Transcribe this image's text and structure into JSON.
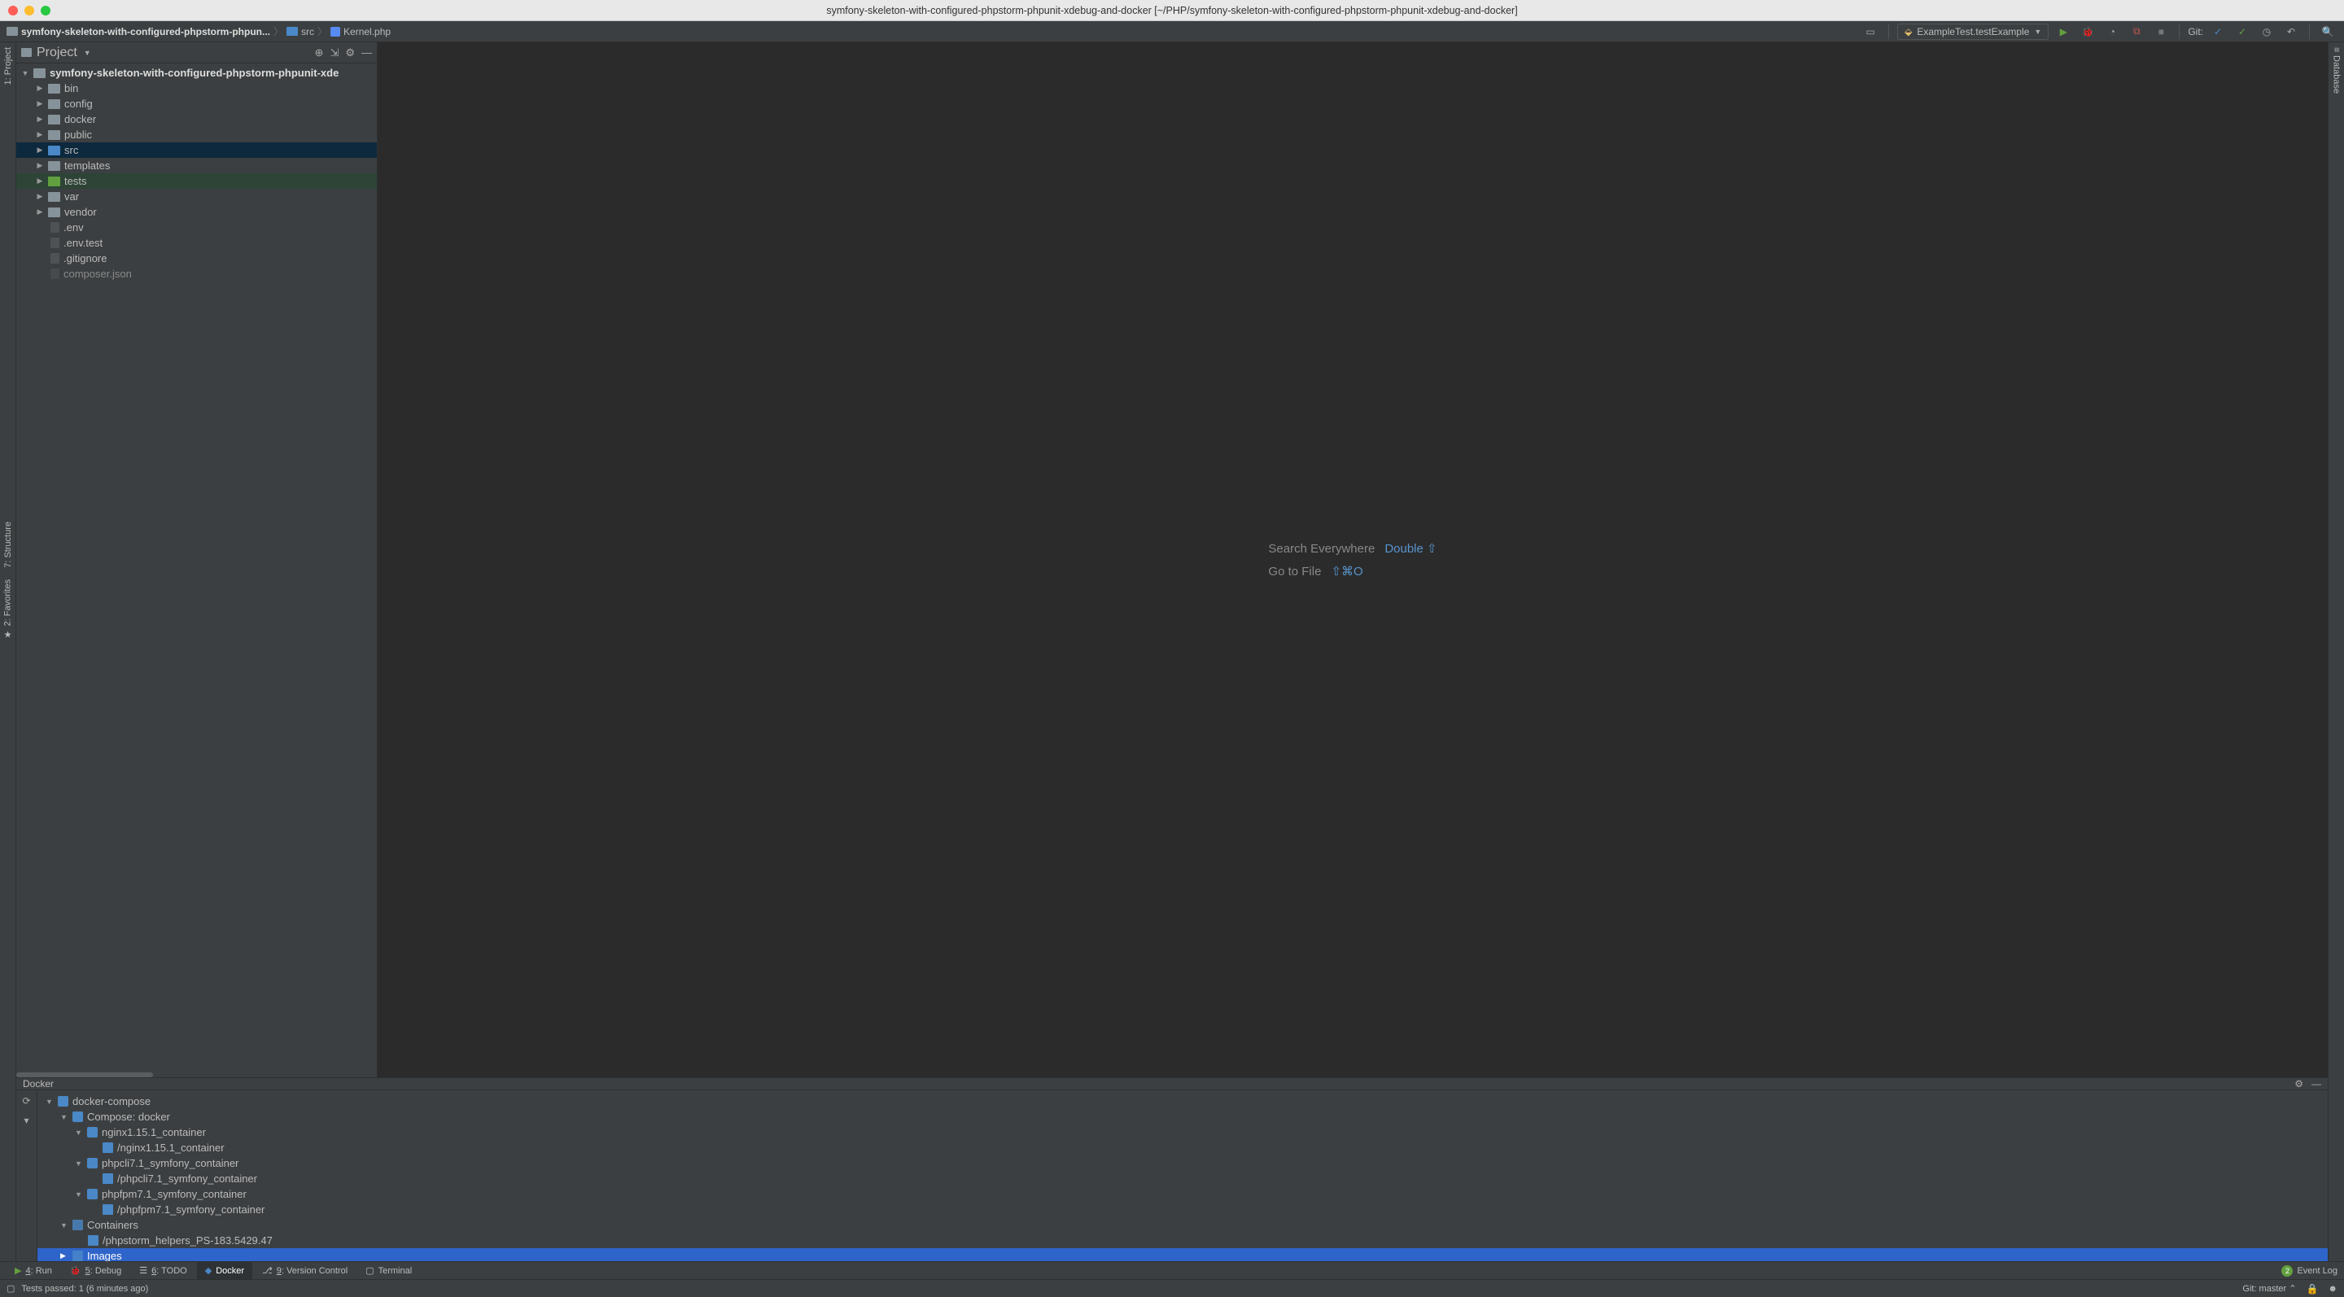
{
  "title": "symfony-skeleton-with-configured-phpstorm-phpunit-xdebug-and-docker [~/PHP/symfony-skeleton-with-configured-phpstorm-phpunit-xdebug-and-docker]",
  "breadcrumb": {
    "root": "symfony-skeleton-with-configured-phpstorm-phpun...",
    "folder": "src",
    "file": "Kernel.php"
  },
  "run_config": "ExampleTest.testExample",
  "git_label": "Git:",
  "left_tabs": {
    "project": "1: Project",
    "structure": "7: Structure",
    "favorites": "2: Favorites"
  },
  "right_tabs": {
    "database": "Database"
  },
  "project_panel": {
    "title": "Project",
    "root": "symfony-skeleton-with-configured-phpstorm-phpunit-xde",
    "folders": [
      "bin",
      "config",
      "docker",
      "public",
      "src",
      "templates",
      "tests",
      "var",
      "vendor"
    ],
    "files": [
      ".env",
      ".env.test",
      ".gitignore",
      "composer.json"
    ]
  },
  "editor_hints": {
    "search": "Search Everywhere",
    "search_key": "Double ⇧",
    "gotofile": "Go to File",
    "gotofile_key": "⇧⌘O"
  },
  "docker": {
    "title": "Docker",
    "root": "docker-compose",
    "compose_label": "Compose: docker",
    "services": [
      {
        "name": "nginx1.15.1_container",
        "child": "/nginx1.15.1_container"
      },
      {
        "name": "phpcli7.1_symfony_container",
        "child": "/phpcli7.1_symfony_container"
      },
      {
        "name": "phpfpm7.1_symfony_container",
        "child": "/phpfpm7.1_symfony_container"
      }
    ],
    "containers_label": "Containers",
    "container_item": "/phpstorm_helpers_PS-183.5429.47",
    "images_label": "Images"
  },
  "bottom_tabs": {
    "run": "4: Run",
    "debug": "5: Debug",
    "todo": "6: TODO",
    "docker": "Docker",
    "vcs": "9: Version Control",
    "terminal": "Terminal",
    "event_log": "Event Log",
    "event_badge": "2"
  },
  "status": {
    "tests": "Tests passed: 1 (6 minutes ago)",
    "git_branch": "Git: master"
  }
}
